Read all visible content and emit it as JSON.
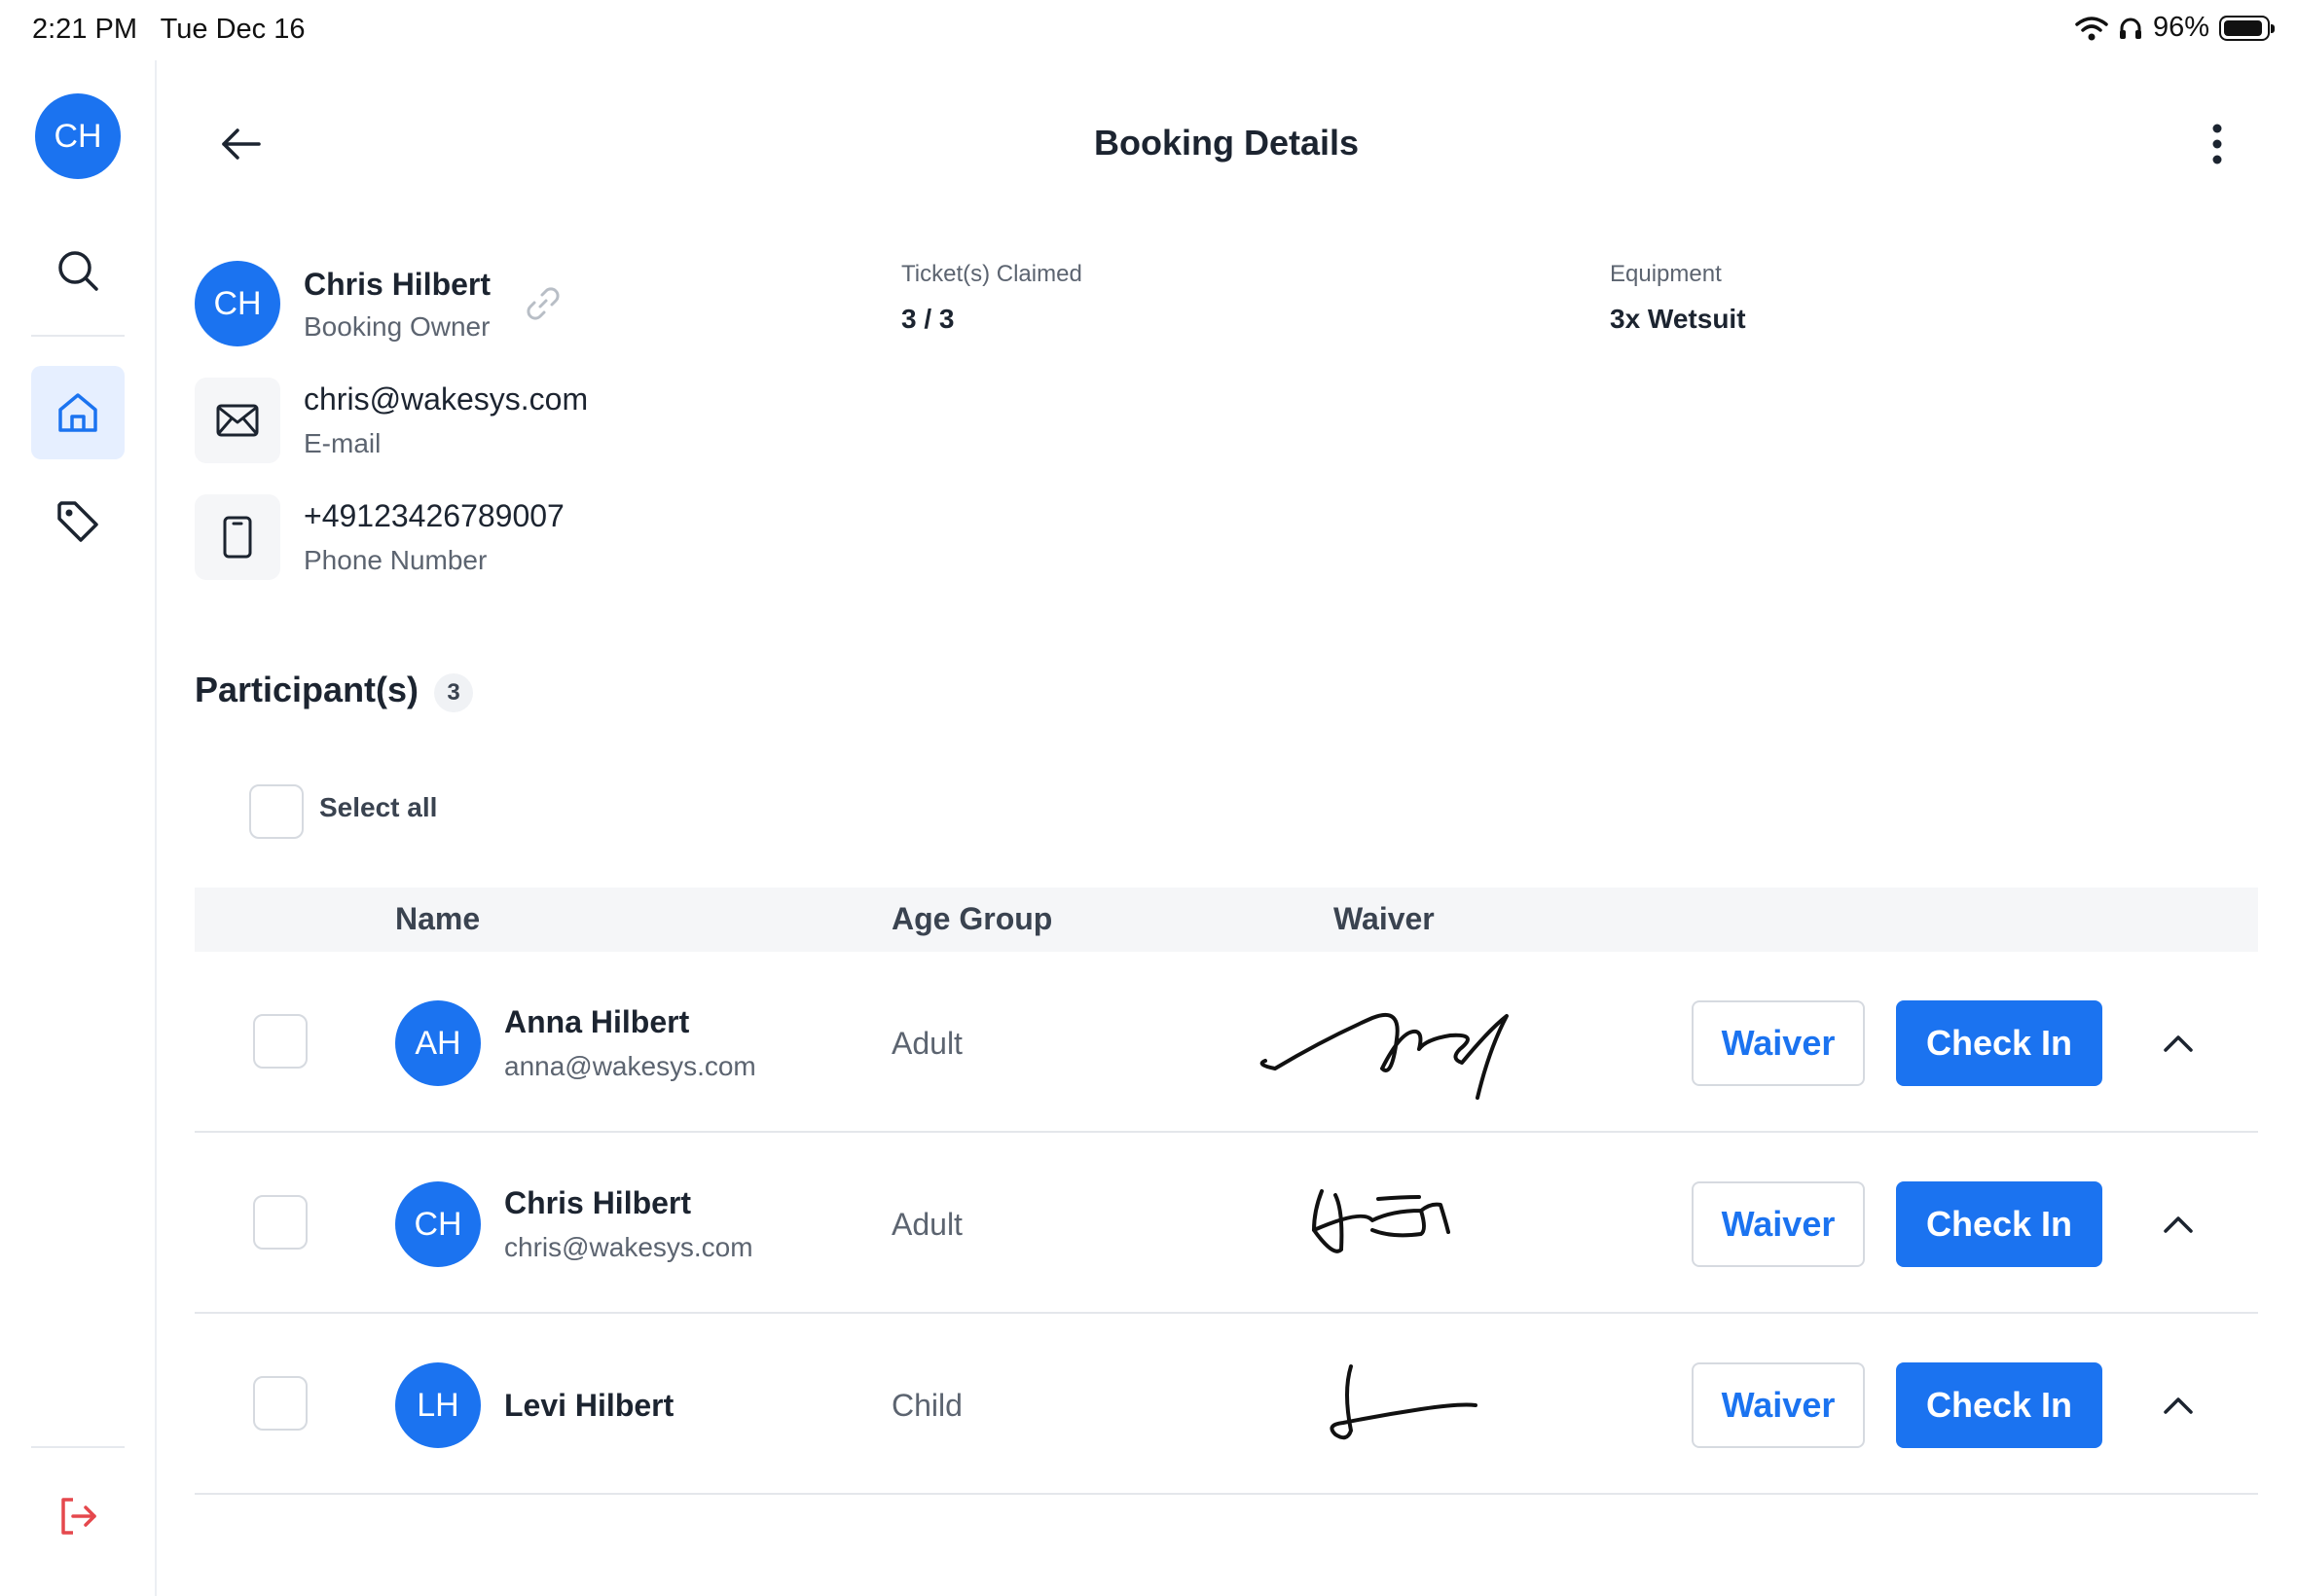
{
  "status_bar": {
    "time": "2:21 PM",
    "date": "Tue Dec 16",
    "battery": "96%",
    "icons": [
      "wifi-icon",
      "headphones-icon",
      "battery-icon"
    ]
  },
  "sidebar": {
    "avatar_initials": "CH",
    "items": [
      {
        "name": "search",
        "icon": "search-icon"
      },
      {
        "name": "home",
        "icon": "home-icon",
        "active": true
      },
      {
        "name": "tags",
        "icon": "tag-icon"
      }
    ],
    "logout_icon": "logout-icon"
  },
  "header": {
    "title": "Booking Details",
    "back_icon": "arrow-left-icon",
    "more_icon": "more-vertical-icon"
  },
  "owner": {
    "initials": "CH",
    "name": "Chris Hilbert",
    "role": "Booking Owner",
    "email": "chris@wakesys.com",
    "email_label": "E-mail",
    "phone": "+49123426789007",
    "phone_label": "Phone Number"
  },
  "tickets": {
    "label": "Ticket(s) Claimed",
    "value": "3 / 3"
  },
  "equipment": {
    "label": "Equipment",
    "value": "3x Wetsuit"
  },
  "participants": {
    "title": "Participant(s)",
    "count": "3",
    "select_all": "Select all",
    "columns": {
      "name": "Name",
      "age_group": "Age Group",
      "waiver": "Waiver"
    },
    "rows": [
      {
        "initials": "AH",
        "name": "Anna Hilbert",
        "email": "anna@wakesys.com",
        "age_group": "Adult",
        "waiver_button": "Waiver",
        "checkin_button": "Check In"
      },
      {
        "initials": "CH",
        "name": "Chris Hilbert",
        "email": "chris@wakesys.com",
        "age_group": "Adult",
        "waiver_button": "Waiver",
        "checkin_button": "Check In"
      },
      {
        "initials": "LH",
        "name": "Levi Hilbert",
        "email": "",
        "age_group": "Child",
        "waiver_button": "Waiver",
        "checkin_button": "Check In"
      }
    ]
  },
  "colors": {
    "accent": "#1b73f0",
    "logout": "#e5484d",
    "active_bg": "#e6efff"
  }
}
